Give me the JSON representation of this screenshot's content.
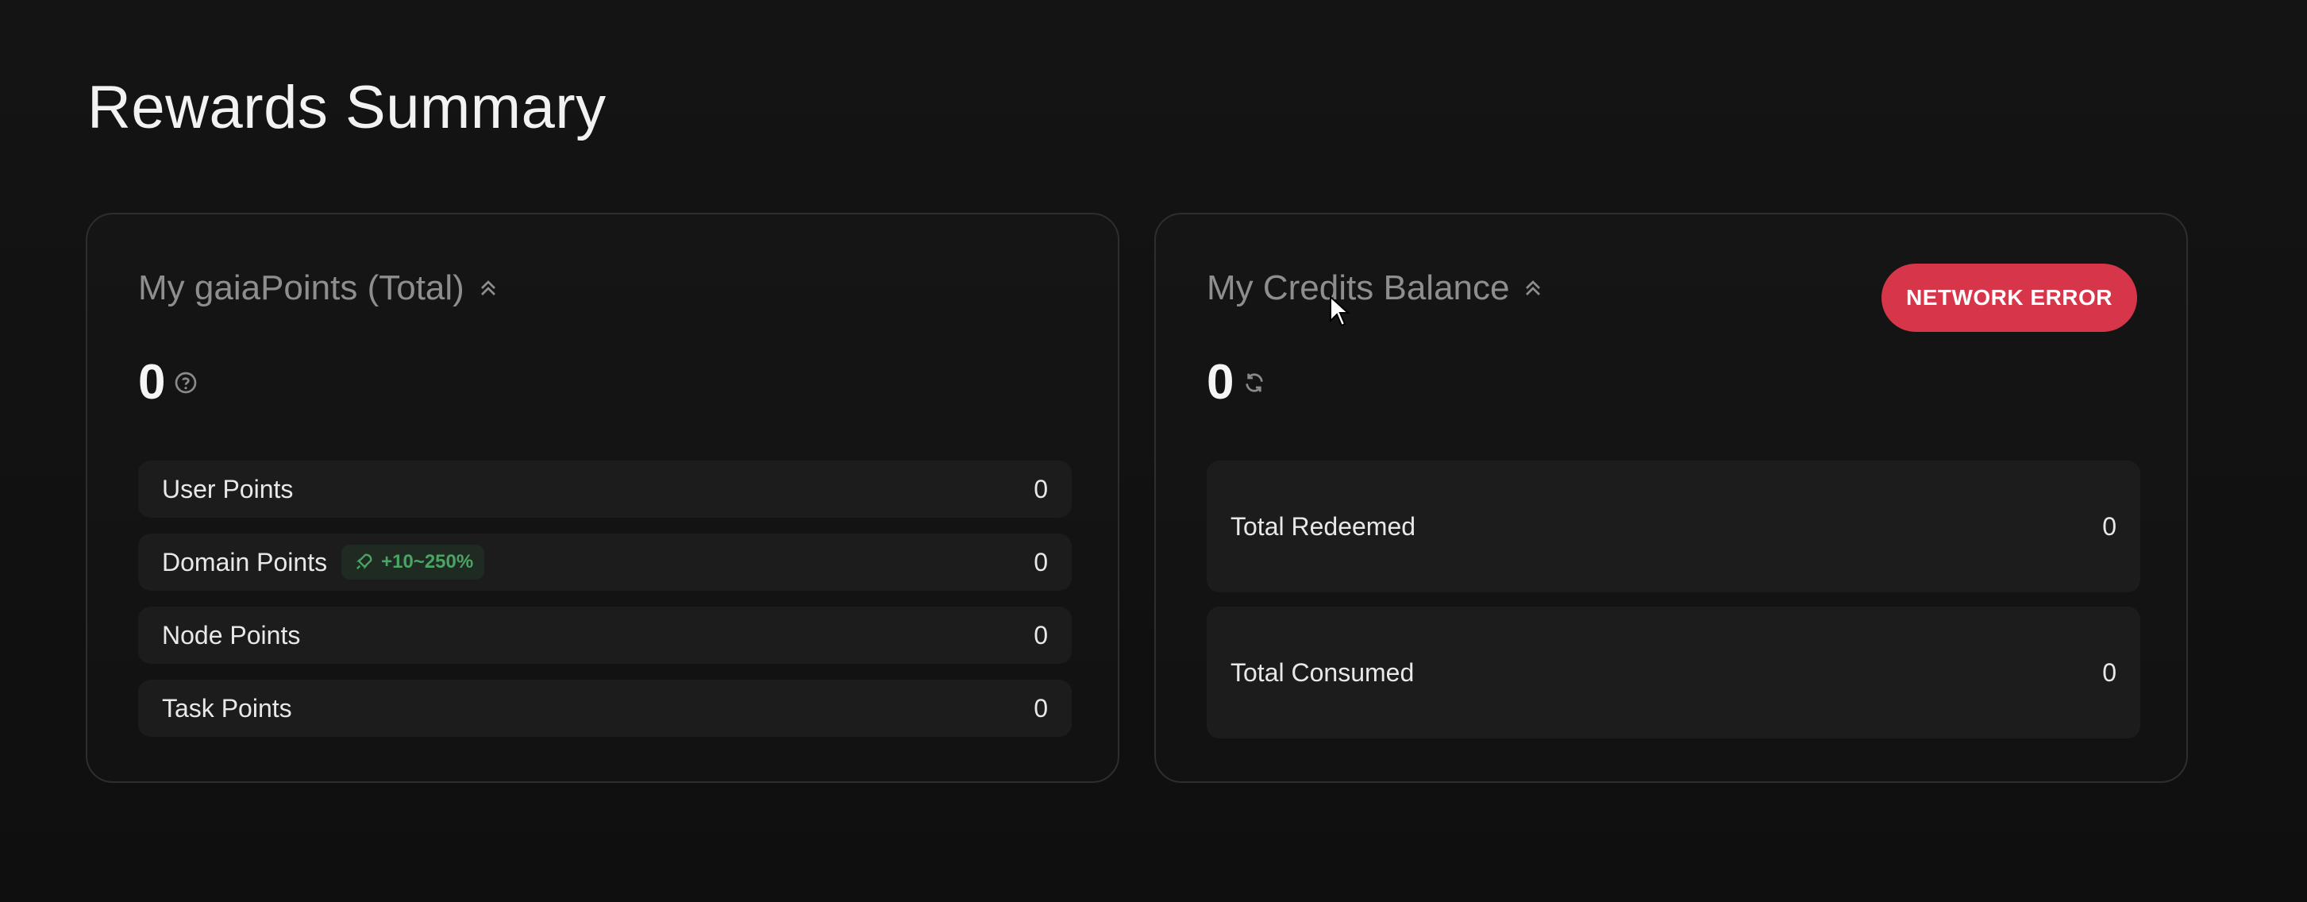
{
  "page": {
    "title": "Rewards Summary"
  },
  "points_card": {
    "title": "My gaiaPoints (Total)",
    "total": "0",
    "rows": [
      {
        "label": "User Points",
        "value": "0"
      },
      {
        "label": "Domain Points",
        "value": "0",
        "badge": "+10~250%"
      },
      {
        "label": "Node Points",
        "value": "0"
      },
      {
        "label": "Task Points",
        "value": "0"
      }
    ]
  },
  "credits_card": {
    "title": "My Credits Balance",
    "total": "0",
    "status": "NETWORK ERROR",
    "rows": [
      {
        "label": "Total Redeemed",
        "value": "0"
      },
      {
        "label": "Total Consumed",
        "value": "0"
      }
    ]
  },
  "icons": {
    "collapse": "double-chevron-up-icon",
    "help": "question-circle-icon",
    "refresh": "refresh-icon",
    "boost": "rocket-icon"
  },
  "colors": {
    "background": "#111111",
    "card_border": "#2e2e2e",
    "row_background": "#1c1c1c",
    "error": "#d7354a",
    "boost_text": "#4aa463"
  }
}
